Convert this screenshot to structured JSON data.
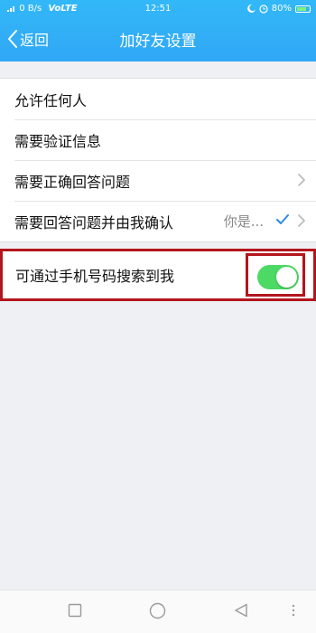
{
  "status_bar": {
    "network_speed": "0 B/s",
    "volte": "VoLTE",
    "time": "12:51",
    "battery": "80%"
  },
  "header": {
    "back_label": "返回",
    "title": "加好友设置"
  },
  "options": [
    {
      "label": "允许任何人"
    },
    {
      "label": "需要验证信息"
    },
    {
      "label": "需要正确回答问题"
    },
    {
      "label": "需要回答问题并由我确认",
      "hint": "你是..."
    }
  ],
  "phone_search": {
    "label": "可通过手机号码搜索到我",
    "enabled": true
  },
  "colors": {
    "header_top": "#32b8f8",
    "header_bottom": "#31a7f5",
    "toggle_on": "#4cd964",
    "highlight_border": "#b3151c",
    "checkmark": "#2a8be8"
  },
  "navbar": {
    "icons": [
      "square-icon",
      "circle-icon",
      "triangle-back-icon",
      "more-dots-icon"
    ]
  }
}
